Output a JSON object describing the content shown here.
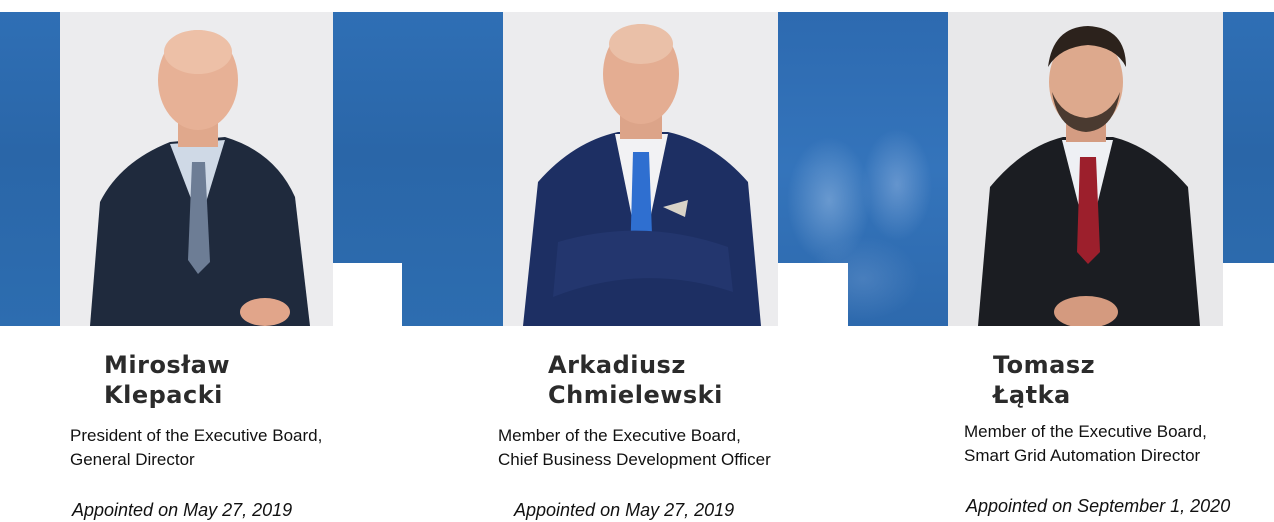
{
  "board_members": [
    {
      "first_name": "Mirosław",
      "last_name": "Klepacki",
      "role_line1": "President of the Executive Board,",
      "role_line2": "General Director",
      "appointed": "Appointed on May 27, 2019"
    },
    {
      "first_name": "Arkadiusz",
      "last_name": "Chmielewski",
      "role_line1": "Member of the Executive Board,",
      "role_line2": "Chief Business Development Officer",
      "appointed": "Appointed on May 27, 2019"
    },
    {
      "first_name": "Tomasz",
      "last_name": "Łątka",
      "role_line1": "Member of the Executive Board,",
      "role_line2": "Smart Grid Automation Director",
      "appointed": "Appointed on September 1, 2020"
    }
  ],
  "colors": {
    "accent_blue": "#2c6cb0",
    "photo_background": "#e9e9ec",
    "text_dark": "#2b2b2b"
  }
}
